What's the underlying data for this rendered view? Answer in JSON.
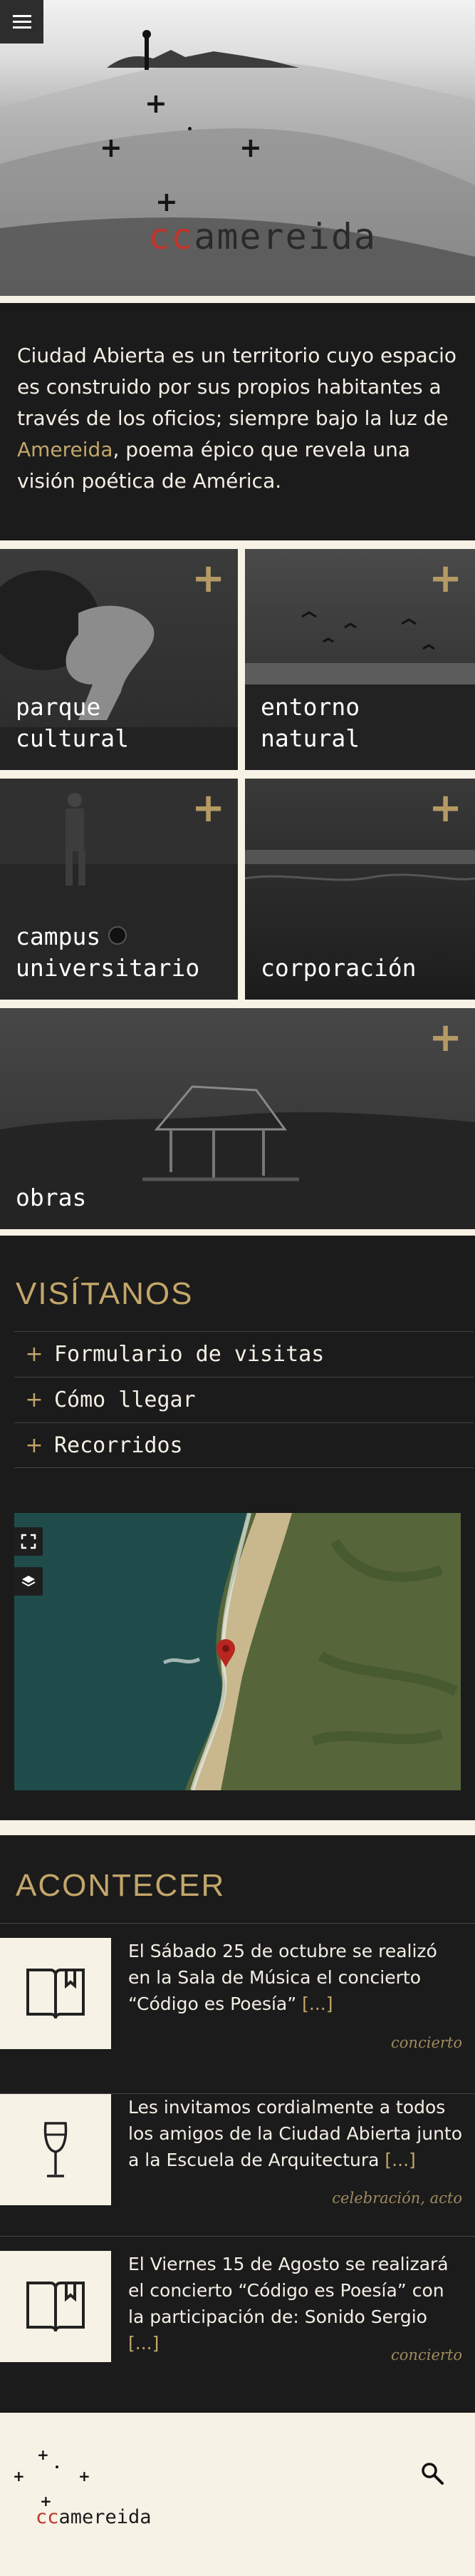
{
  "hero": {
    "logo_prefix": "cc",
    "logo_suffix": "amereida"
  },
  "intro": {
    "text_before": "Ciudad Abierta es un territorio cuyo espacio es construido por sus propios habitantes a través de los oficios; siempre bajo la luz de ",
    "highlight": "Amereida",
    "text_after": ", poema épico que revela una visión poética de América."
  },
  "tiles": [
    {
      "label": "parque\ncultural"
    },
    {
      "label": "entorno\nnatural"
    },
    {
      "label": "campus\nuniversitario"
    },
    {
      "label": "corporación"
    },
    {
      "label": "obras"
    }
  ],
  "tile_plus": "+",
  "visit": {
    "title": "VISÍTANOS",
    "items": [
      {
        "label": "Formulario de visitas"
      },
      {
        "label": "Cómo llegar"
      },
      {
        "label": "Recorridos"
      }
    ]
  },
  "acontecer": {
    "title": "ACONTECER",
    "more_label": "[...]",
    "events": [
      {
        "icon": "book-icon",
        "text": "El Sábado 25 de octubre se realizó en la Sala de Música el concierto “Código es Poesía”",
        "tag": "concierto"
      },
      {
        "icon": "wine-glass-icon",
        "text": "Les invitamos cordialmente a todos los amigos de la Ciudad Abierta junto a la Escuela de Arquitectura",
        "tag": "celebración, acto"
      },
      {
        "icon": "book-icon",
        "text": "El Viernes 15 de Agosto se realizará el concierto “Código es Poesía” con la participación de: Sonido Sergio",
        "tag": "concierto"
      }
    ]
  },
  "footer": {
    "logo_prefix": "cc",
    "logo_suffix": "amereida"
  },
  "colors": {
    "accent_gold": "#c3a66a",
    "logo_red": "#c2342b",
    "dark_bg": "#1b1b1b",
    "cream": "#f7f2e6"
  }
}
